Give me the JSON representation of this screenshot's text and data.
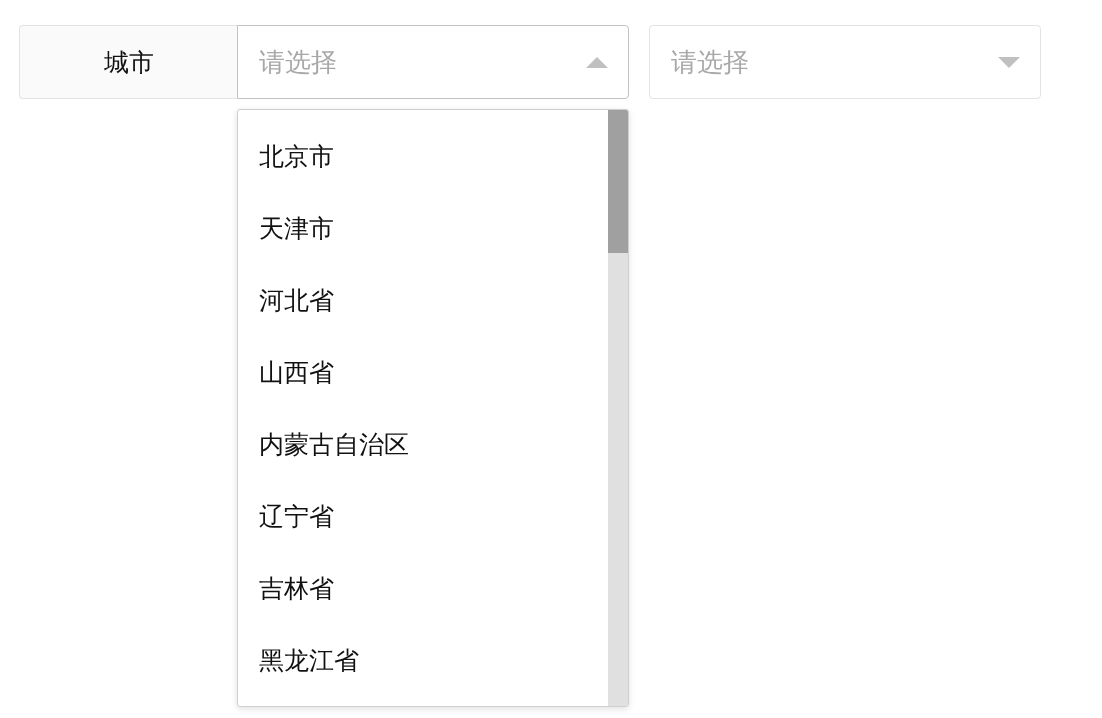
{
  "filter": {
    "label": "城市",
    "selects": [
      {
        "placeholder": "请选择",
        "expanded": true,
        "options": [
          {
            "label": "北京市",
            "selected": false
          },
          {
            "label": "天津市",
            "selected": false
          },
          {
            "label": "河北省",
            "selected": false
          },
          {
            "label": "山西省",
            "selected": false
          },
          {
            "label": "内蒙古自治区",
            "selected": false
          },
          {
            "label": "辽宁省",
            "selected": false
          },
          {
            "label": "吉林省",
            "selected": false
          },
          {
            "label": "黑龙江省",
            "selected": false
          }
        ]
      },
      {
        "placeholder": "请选择",
        "expanded": false
      }
    ]
  }
}
